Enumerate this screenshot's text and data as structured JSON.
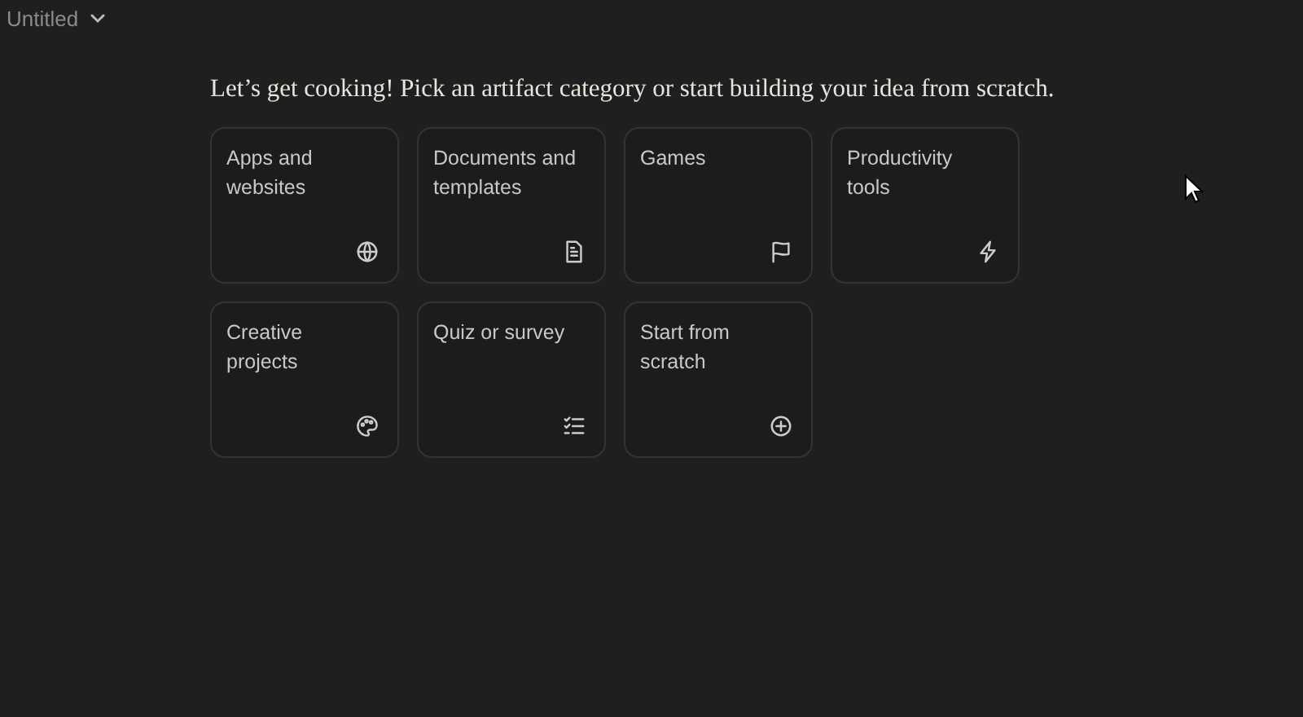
{
  "header": {
    "title": "Untitled"
  },
  "prompt": "Let’s get cooking! Pick an artifact category or start building your idea from scratch.",
  "categories": [
    {
      "label": "Apps and websites",
      "kind": "globe"
    },
    {
      "label": "Documents and templates",
      "kind": "document"
    },
    {
      "label": "Games",
      "kind": "flag"
    },
    {
      "label": "Productivity tools",
      "kind": "bolt"
    },
    {
      "label": "Creative projects",
      "kind": "palette"
    },
    {
      "label": "Quiz or survey",
      "kind": "checklist"
    },
    {
      "label": "Start from scratch",
      "kind": "plus"
    }
  ]
}
